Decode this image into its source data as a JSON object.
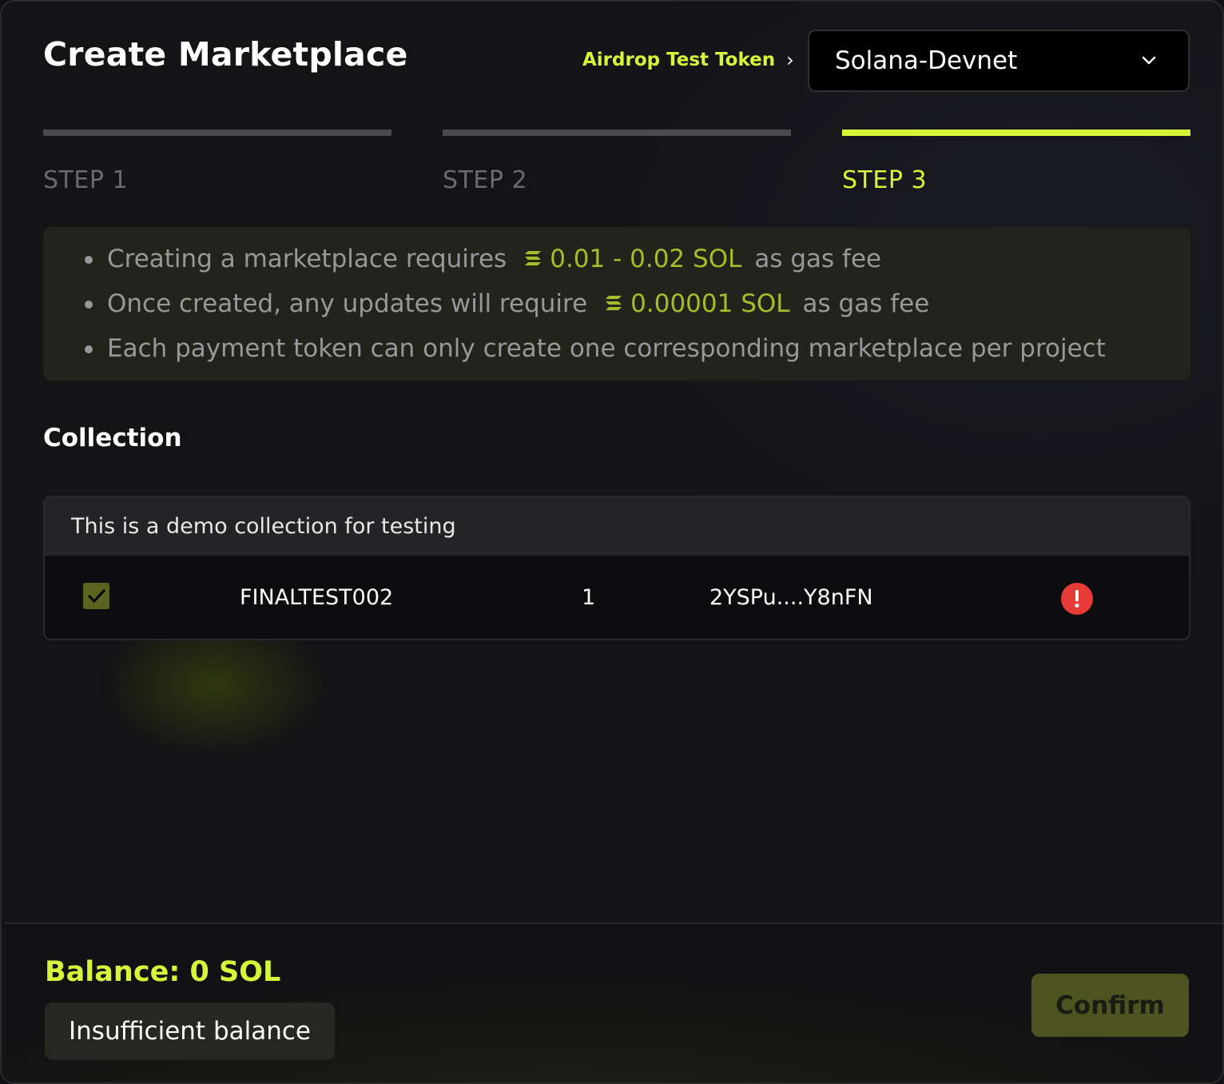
{
  "header": {
    "title": "Create Marketplace",
    "airdrop_link": "Airdrop Test Token",
    "airdrop_chevron": "›",
    "network_select": {
      "value": "Solana-Devnet",
      "icon": "chevron-down-icon"
    }
  },
  "steps": [
    {
      "label": "STEP 1",
      "active": false
    },
    {
      "label": "STEP 2",
      "active": false
    },
    {
      "label": "STEP 3",
      "active": true
    }
  ],
  "info": {
    "items": [
      {
        "prefix": "Creating a marketplace requires",
        "amount": "0.01 - 0.02 SOL",
        "suffix": "as gas fee",
        "icon": "solana-icon"
      },
      {
        "prefix": "Once created, any updates will require",
        "amount": "0.00001 SOL",
        "suffix": "as gas fee",
        "icon": "solana-icon"
      },
      {
        "prefix": "Each payment token can only create one corresponding marketplace per project"
      }
    ]
  },
  "collection": {
    "section_title": "Collection",
    "description": "This is a demo collection for testing",
    "rows": [
      {
        "checked": true,
        "name": "FINALTEST002",
        "count": "1",
        "address": "2YSPu....Y8nFN",
        "status_icon": "warning-icon"
      }
    ]
  },
  "footer": {
    "balance": "Balance: 0 SOL",
    "status": "Insufficient balance",
    "confirm_label": "Confirm"
  },
  "colors": {
    "accent": "#d8f53a",
    "amount": "#a6bd2c",
    "warning": "#e63b36",
    "background": "#141416"
  }
}
